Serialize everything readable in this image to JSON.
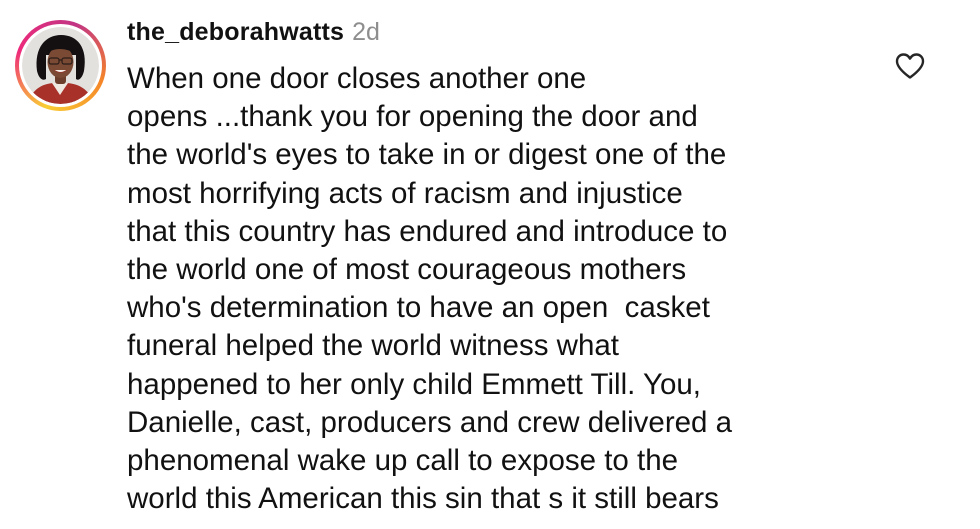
{
  "comment": {
    "username": "the_deborahwatts",
    "timestamp": "2d",
    "lines": [
      "When one door closes another one",
      "opens ...thank you for opening the door and",
      "the world's eyes to take in or digest one of the",
      "most horrifying acts of racism and injustice",
      "that this country has endured and introduce to",
      "the world one of most courageous mothers",
      "who's determination to have an open  casket",
      "funeral helped the world witness what",
      "happened to her only child Emmett Till. You,",
      "Danielle, cast, producers and crew delivered a",
      "phenomenal wake up call to expose to the",
      "world this American this sin that s it still bears"
    ],
    "like_icon": "heart-outline-icon",
    "story_ring_colors": [
      "#f9ce34",
      "#ee2a7b",
      "#c13584",
      "#f58529"
    ]
  }
}
